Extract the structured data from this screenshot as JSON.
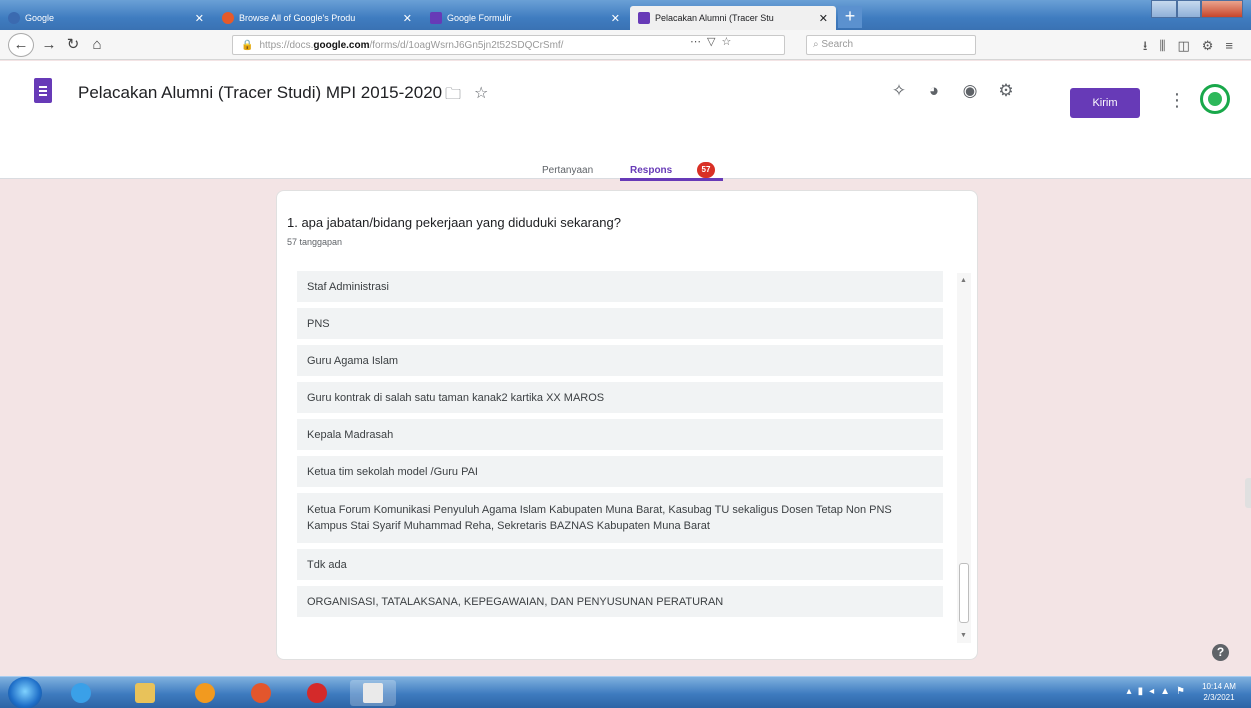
{
  "browser": {
    "tabs": [
      {
        "title": "Google",
        "favicon_color": "#3b6ab0"
      },
      {
        "title": "Browse All of Google's Produ",
        "favicon_color": "#e65a2a"
      },
      {
        "title": "Google Formulir",
        "favicon_color": "#673ab7"
      },
      {
        "title": "Pelacakan Alumni (Tracer Stu",
        "favicon_color": "#673ab7"
      }
    ],
    "new_tab_label": "+",
    "url_prefix": "https://docs.",
    "url_domain": "google.com",
    "url_rest": "/forms/d/1oagWsrnJ6Gn5jn2t52SDQCrSmf/",
    "search_placeholder": "Search"
  },
  "form": {
    "title": "Pelacakan Alumni (Tracer Studi) MPI 2015-2020",
    "send_label": "Kirim",
    "tabs": {
      "questions": "Pertanyaan",
      "responses": "Respons",
      "response_count": "57"
    }
  },
  "question": {
    "title": "1. apa jabatan/bidang pekerjaan yang diduduki sekarang?",
    "count_label": "57 tanggapan",
    "responses": [
      "Staf Administrasi",
      "PNS",
      "Guru Agama Islam",
      "Guru kontrak di salah satu taman kanak2 kartika XX MAROS",
      "Kepala Madrasah",
      "Ketua tim sekolah model /Guru PAI",
      "Ketua Forum Komunikasi Penyuluh Agama Islam Kabupaten Muna Barat, Kasubag TU sekaligus Dosen Tetap Non PNS Kampus Stai Syarif Muhammad Reha, Sekretaris BAZNAS Kabupaten Muna Barat",
      "Tdk ada",
      "ORGANISASI, TATALAKSANA, KEPEGAWAIAN, DAN PENYUSUNAN PERATURAN"
    ]
  },
  "help_label": "?",
  "taskbar": {
    "time": "10:14 AM",
    "date": "2/3/2021"
  },
  "colors": {
    "accent": "#673ab7",
    "badge": "#d93025",
    "page_bg": "#f3e4e5"
  }
}
